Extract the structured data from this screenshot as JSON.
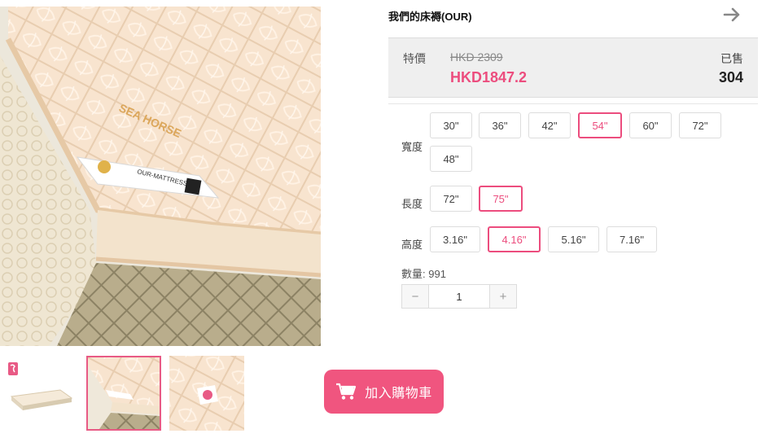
{
  "product": {
    "title": "我們的床褥(OUR)",
    "price_label": "特價",
    "original_price": "HKD 2309",
    "sale_price": "HKD1847.2",
    "sold_label": "已售",
    "sold_count": "304"
  },
  "image_texts": {
    "brand_stamp": "SEA HORSE",
    "tag_text": "OUR-MATTRESS"
  },
  "options": {
    "width": {
      "label": "寬度",
      "values": [
        "30\"",
        "36\"",
        "42\"",
        "54\"",
        "60\"",
        "72\"",
        "48\""
      ],
      "selected": "54\""
    },
    "length": {
      "label": "長度",
      "values": [
        "72\"",
        "75\""
      ],
      "selected": "75\""
    },
    "height": {
      "label": "高度",
      "values": [
        "3.16\"",
        "4.16\"",
        "5.16\"",
        "7.16\""
      ],
      "selected": "4.16\""
    }
  },
  "quantity": {
    "label": "數量:",
    "available": "991",
    "value": "1",
    "minus": "−",
    "plus": "+"
  },
  "cart": {
    "label": "加入購物車"
  },
  "icons": {
    "next": "arrow-right-icon",
    "cart": "shopping-cart-icon"
  },
  "colors": {
    "accent": "#ec4d7e",
    "cart_button": "#f0557f",
    "price_box": "#efefef"
  }
}
